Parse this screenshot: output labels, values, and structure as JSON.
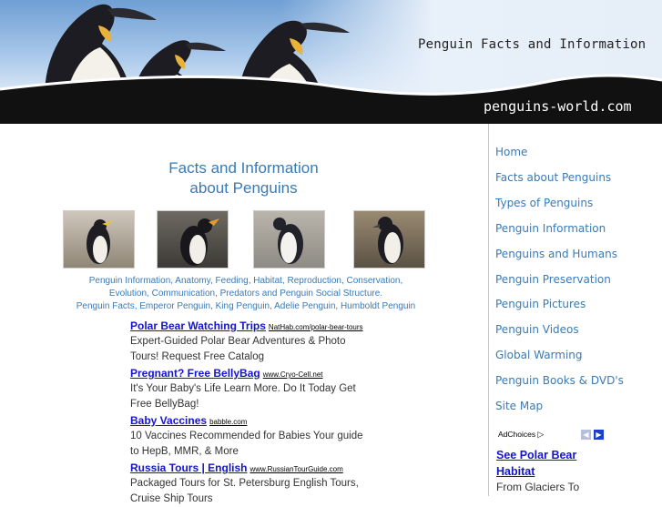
{
  "header": {
    "site_title": "Penguin Facts and Information",
    "domain": "penguins-world.com"
  },
  "main": {
    "heading_line1": "Facts and Information",
    "heading_line2": "about Penguins",
    "topics_line1": "Penguin Information, Anatomy, Feeding, Habitat, Reproduction, Conservation,",
    "topics_line2": "Evolution, Communication, Predators and Penguin Social Structure.",
    "topics_line3": "Penguin Facts, Emperor Penguin, King Penguin, Adelie Penguin, Humboldt Penguin",
    "ads": [
      {
        "title": "Polar Bear Watching Trips",
        "url": "NatHab.com/polar-bear-tours",
        "desc": "Expert-Guided Polar Bear Adventures & Photo Tours! Request Free Catalog"
      },
      {
        "title": "Pregnant? Free BellyBag",
        "url": "www.Cryo-Cell.net",
        "desc": "It's Your Baby's Life Learn More. Do It Today Get Free BellyBag!"
      },
      {
        "title": "Baby Vaccines",
        "url": "babble.com",
        "desc": "10 Vaccines Recommended for Babies Your guide to HepB, MMR, & More"
      },
      {
        "title": "Russia Tours | English",
        "url": "www.RussianTourGuide.com",
        "desc": "Packaged Tours for St. Petersburg English Tours, Cruise Ship Tours"
      }
    ]
  },
  "sidebar": {
    "nav": [
      "Home",
      "Facts about Penguins",
      "Types of Penguins",
      "Penguin Information",
      "Penguins and Humans",
      "Penguin Preservation",
      "Penguin Pictures",
      "Penguin Videos",
      "Global Warming",
      "Penguin Books & DVD's",
      "Site Map"
    ],
    "adchoices": "AdChoices",
    "ad_title": "See Polar Bear Habitat",
    "ad_desc": "From Glaciers To"
  },
  "colors": {
    "link_blue": "#3a7ab5",
    "ad_blue": "#1515cc",
    "adchoices_arrow": "#1a3fd0"
  },
  "icons": [
    "emperor-penguin-illustration",
    "rockhopper-penguin-photo",
    "macaroni-penguin-photo",
    "african-penguin-photo",
    "humboldt-penguin-photo",
    "adchoices-icon",
    "prev-arrow-icon",
    "next-arrow-icon"
  ]
}
